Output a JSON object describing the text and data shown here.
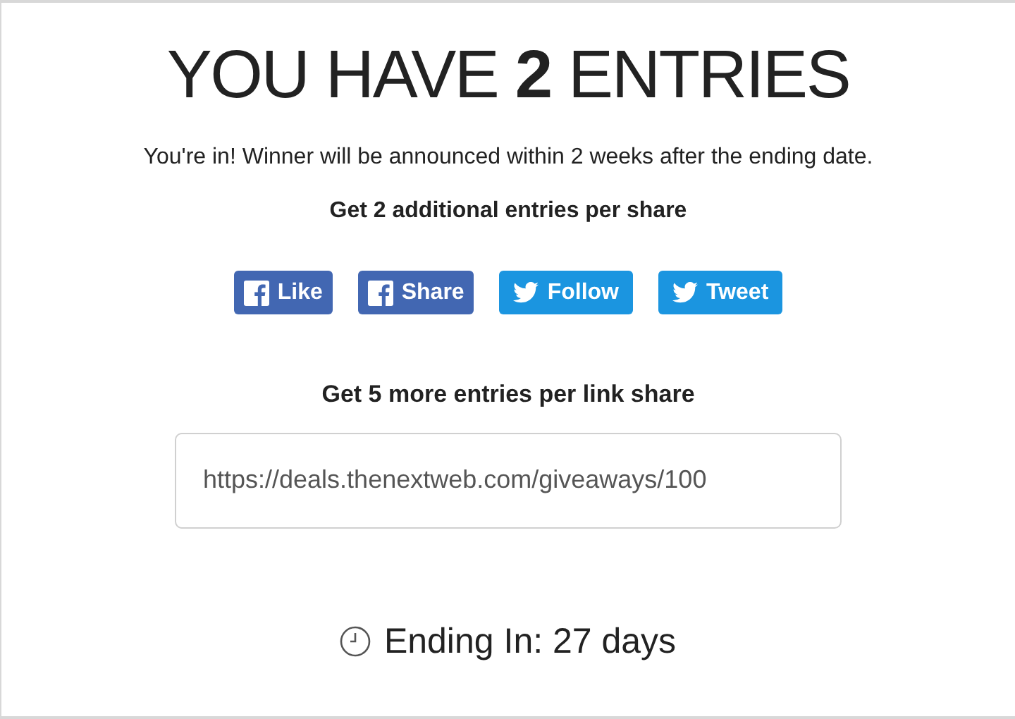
{
  "heading": "YOU HAVE **2** ENTRIES",
  "message": "You're in! Winner will be announced within 2 weeks after the ending date.",
  "share_prompt": "Get 2 additional entries per share",
  "social_buttons": [
    {
      "kind": "facebook",
      "label": "Like"
    },
    {
      "kind": "facebook",
      "label": "Share"
    },
    {
      "kind": "twitter",
      "label": "Follow"
    },
    {
      "kind": "twitter",
      "label": "Tweet"
    }
  ],
  "link_prompt": "Get 5 more entries per link share",
  "link_field": {
    "value": "https://deals.thenextweb.com/giveaways/100"
  },
  "countdown": "Ending In: 27 days"
}
